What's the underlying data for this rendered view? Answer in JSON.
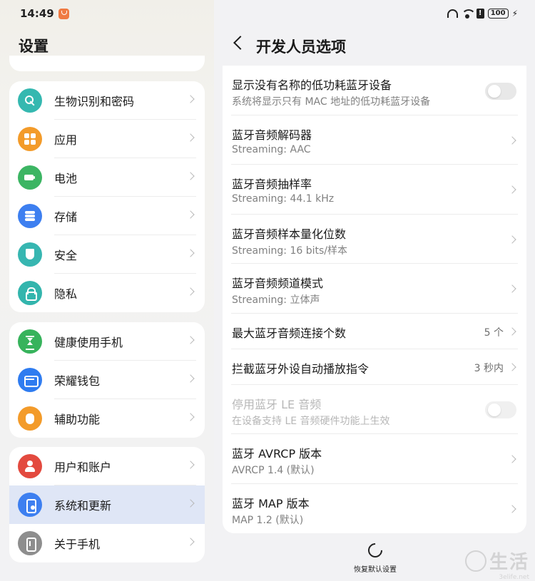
{
  "status": {
    "time": "14:49",
    "battery": "100"
  },
  "left": {
    "title": "设置",
    "groups": [
      {
        "items": [
          {
            "label": "生物识别和密码",
            "icon": "key-icon",
            "color": "#35b8b0"
          },
          {
            "label": "应用",
            "icon": "apps-icon",
            "color": "#f39b2a"
          },
          {
            "label": "电池",
            "icon": "battery-icon",
            "color": "#3cb563"
          },
          {
            "label": "存储",
            "icon": "storage-icon",
            "color": "#3d7ff0"
          },
          {
            "label": "安全",
            "icon": "shield-icon",
            "color": "#37b6b1"
          },
          {
            "label": "隐私",
            "icon": "lock-icon",
            "color": "#33b5ad"
          }
        ]
      },
      {
        "items": [
          {
            "label": "健康使用手机",
            "icon": "hourglass-icon",
            "color": "#37b35c"
          },
          {
            "label": "荣耀钱包",
            "icon": "wallet-icon",
            "color": "#2f7cf0"
          },
          {
            "label": "辅助功能",
            "icon": "hand-icon",
            "color": "#f39b2a"
          }
        ]
      },
      {
        "items": [
          {
            "label": "用户和账户",
            "icon": "user-icon",
            "color": "#e34a3f"
          },
          {
            "label": "系统和更新",
            "icon": "system-update-icon",
            "color": "#3d7ff0"
          },
          {
            "label": "关于手机",
            "icon": "phone-info-icon",
            "color": "#8e8e8e"
          }
        ]
      }
    ]
  },
  "right": {
    "title": "开发人员选项",
    "rows": [
      {
        "title": "显示没有名称的低功耗蓝牙设备",
        "subtitle": "系统将显示只有 MAC 地址的低功耗蓝牙设备",
        "control": "toggle"
      },
      {
        "title": "蓝牙音频解码器",
        "subtitle": "Streaming: AAC",
        "control": "chevron"
      },
      {
        "title": "蓝牙音频抽样率",
        "subtitle": "Streaming: 44.1 kHz",
        "control": "chevron"
      },
      {
        "title": "蓝牙音频样本量化位数",
        "subtitle": "Streaming: 16 bits/样本",
        "control": "chevron"
      },
      {
        "title": "蓝牙音频频道模式",
        "subtitle": "Streaming: 立体声",
        "control": "chevron"
      },
      {
        "title": "最大蓝牙音频连接个数",
        "value": "5 个",
        "control": "chevron"
      },
      {
        "title": "拦截蓝牙外设自动播放指令",
        "value": "3 秒内",
        "control": "chevron"
      },
      {
        "title": "停用蓝牙 LE 音频",
        "subtitle": "在设备支持 LE 音频硬件功能上生效",
        "control": "toggle"
      },
      {
        "title": "蓝牙 AVRCP 版本",
        "subtitle": "AVRCP 1.4 (默认)",
        "control": "chevron"
      },
      {
        "title": "蓝牙 MAP 版本",
        "subtitle": "MAP 1.2 (默认)",
        "control": "chevron"
      }
    ],
    "reset_label": "恢复默认设置"
  },
  "watermark": {
    "text": "生活",
    "url": "3elife.net"
  }
}
